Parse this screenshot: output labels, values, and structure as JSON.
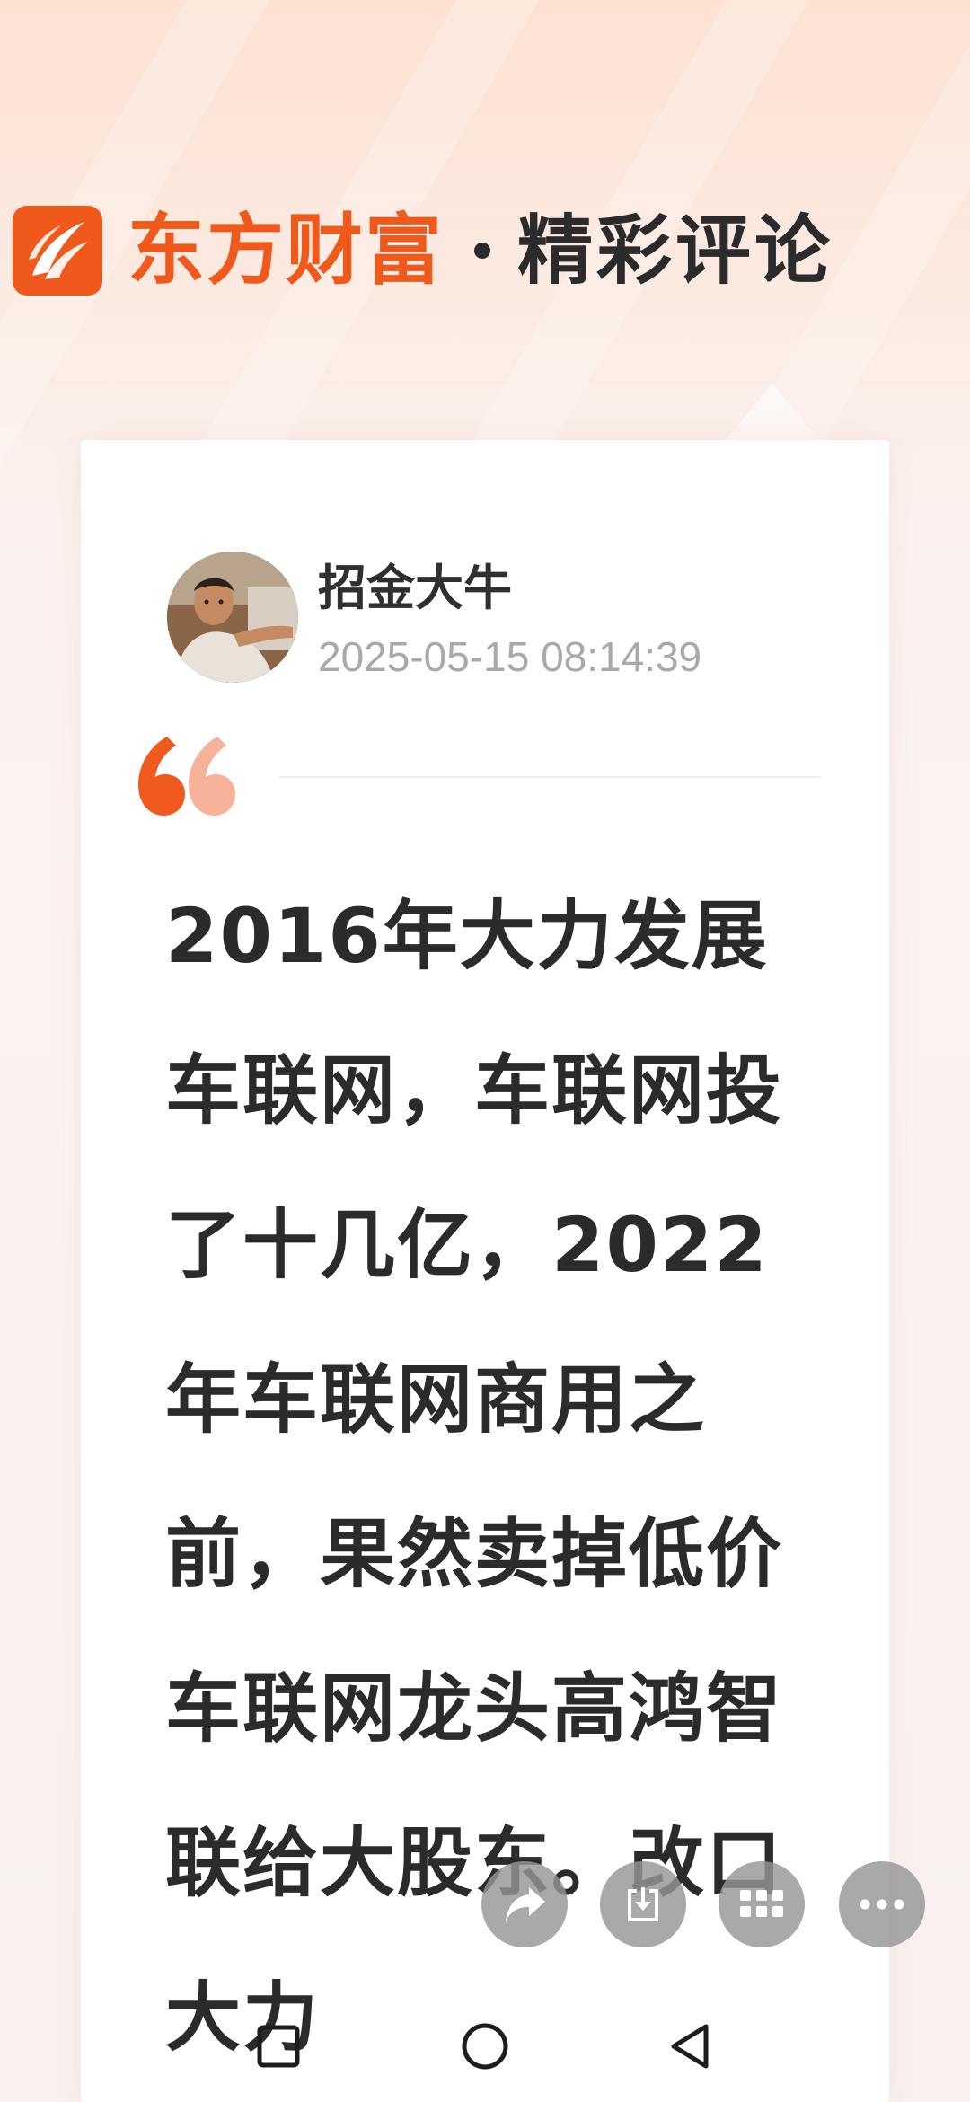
{
  "header": {
    "brand_name": "东方财富",
    "brand_subtitle": "精彩评论",
    "logo_icon": "eastmoney-logo-icon",
    "brand_color": "#ef5a1c"
  },
  "comment": {
    "author": "招金大牛",
    "time": "2025-05-15 08:14:39",
    "avatar_icon": "user-avatar",
    "quote_icon": "open-quote-icon",
    "text": "2016年大力发展车联网，车联网投了十几亿，2022年车联网商用之前，果然卖掉低价车联网龙头高鸿智联给大股东。改口大力"
  },
  "floating_actions": [
    {
      "name": "share-button",
      "icon": "share-arrow-icon"
    },
    {
      "name": "download-button",
      "icon": "download-icon"
    },
    {
      "name": "apps-button",
      "icon": "grid-icon"
    },
    {
      "name": "more-button",
      "icon": "more-dots-icon"
    }
  ],
  "nav_bar": {
    "recents_icon": "square-icon",
    "home_icon": "circle-icon",
    "back_icon": "triangle-back-icon"
  }
}
